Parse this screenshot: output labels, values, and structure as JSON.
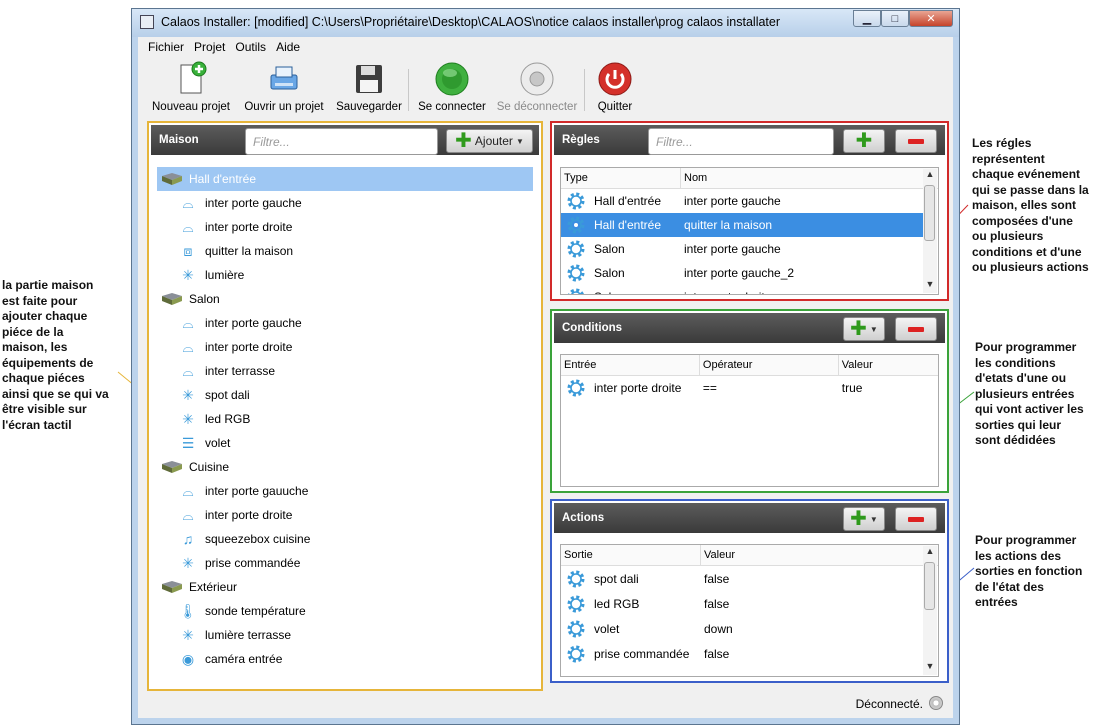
{
  "window": {
    "title": "Calaos Installer: [modified] C:\\Users\\Propriétaire\\Desktop\\CALAOS\\notice calaos installer\\prog calaos installater",
    "minimize": "▁",
    "maximize": "□",
    "close": "✕"
  },
  "menu": [
    "Fichier",
    "Projet",
    "Outils",
    "Aide"
  ],
  "toolbar": {
    "new_project": "Nouveau projet",
    "open_project": "Ouvrir un projet",
    "save": "Sauvegarder",
    "connect": "Se connecter",
    "disconnect": "Se déconnecter",
    "quit": "Quitter"
  },
  "maison": {
    "title": "Maison",
    "filter_placeholder": "Filtre...",
    "add_label": "Ajouter",
    "rooms": [
      {
        "name": "Hall d'entrée",
        "items": [
          {
            "icon": "door-sensor-icon",
            "label": "inter porte gauche"
          },
          {
            "icon": "door-sensor-icon",
            "label": "inter porte droite"
          },
          {
            "icon": "scenario-icon",
            "label": "quitter la maison"
          },
          {
            "icon": "light-icon",
            "label": "lumière"
          }
        ]
      },
      {
        "name": "Salon",
        "items": [
          {
            "icon": "door-sensor-icon",
            "label": "inter porte gauche"
          },
          {
            "icon": "door-sensor-icon",
            "label": "inter porte droite"
          },
          {
            "icon": "door-sensor-icon",
            "label": "inter terrasse"
          },
          {
            "icon": "light-icon",
            "label": "spot dali"
          },
          {
            "icon": "light-icon",
            "label": "led RGB"
          },
          {
            "icon": "shutter-icon",
            "label": "volet"
          }
        ]
      },
      {
        "name": "Cuisine",
        "items": [
          {
            "icon": "door-sensor-icon",
            "label": "inter porte gauuche"
          },
          {
            "icon": "door-sensor-icon",
            "label": "inter porte droite"
          },
          {
            "icon": "music-icon",
            "label": "squeezebox cuisine"
          },
          {
            "icon": "light-icon",
            "label": "prise commandée"
          }
        ]
      },
      {
        "name": "Extérieur",
        "items": [
          {
            "icon": "thermometer-icon",
            "label": "sonde température"
          },
          {
            "icon": "light-icon",
            "label": "lumière terrasse"
          },
          {
            "icon": "camera-icon",
            "label": "caméra entrée"
          }
        ]
      }
    ]
  },
  "regles": {
    "title": "Règles",
    "filter_placeholder": "Filtre...",
    "columns": [
      "Type",
      "Nom"
    ],
    "rows": [
      {
        "type": "Hall d'entrée",
        "nom": "inter porte gauche"
      },
      {
        "type": "Hall d'entrée",
        "nom": "quitter la maison"
      },
      {
        "type": "Salon",
        "nom": "inter porte gauche"
      },
      {
        "type": "Salon",
        "nom": "inter porte gauche_2"
      },
      {
        "type": "Salon",
        "nom": "inter porte droite"
      }
    ],
    "selected_row": 1
  },
  "conditions": {
    "title": "Conditions",
    "columns": [
      "Entrée",
      "Opérateur",
      "Valeur"
    ],
    "rows": [
      {
        "entree": "inter porte droite",
        "operateur": "==",
        "valeur": "true"
      }
    ]
  },
  "actions": {
    "title": "Actions",
    "columns": [
      "Sortie",
      "Valeur"
    ],
    "rows": [
      {
        "sortie": "spot dali",
        "valeur": "false"
      },
      {
        "sortie": "led RGB",
        "valeur": "false"
      },
      {
        "sortie": "volet",
        "valeur": "down"
      },
      {
        "sortie": "prise commandée",
        "valeur": "false"
      }
    ]
  },
  "status": {
    "text": "Déconnecté."
  },
  "annotations": {
    "maison": [
      "la partie maison",
      "est faite pour",
      "ajouter chaque",
      "piéce de la",
      "maison, les",
      "équipements de",
      "chaque piéces",
      "ainsi que se qui va",
      "être visible sur",
      "l'écran tactil"
    ],
    "regles": [
      "Les régles",
      "représentent",
      "chaque evénement",
      "qui se passe dans la",
      "maison, elles sont",
      "composées d'une",
      "ou plusieurs",
      "conditions et d'une",
      "ou plusieurs actions"
    ],
    "conditions": [
      "Pour programmer",
      "les conditions",
      "d'etats d'une ou",
      "plusieurs entrées",
      "qui vont activer les",
      "sorties qui leur",
      "sont dédidées"
    ],
    "actions": [
      "Pour programmer",
      "les actions des",
      "sorties en fonction",
      "de l'état des",
      "entrées"
    ]
  },
  "colors": {
    "maison_border": "#e6b53a",
    "regles_border": "#d22a2a",
    "conditions_border": "#3aa33a",
    "actions_border": "#3b5fc9",
    "selection": "#3b8ee2"
  }
}
